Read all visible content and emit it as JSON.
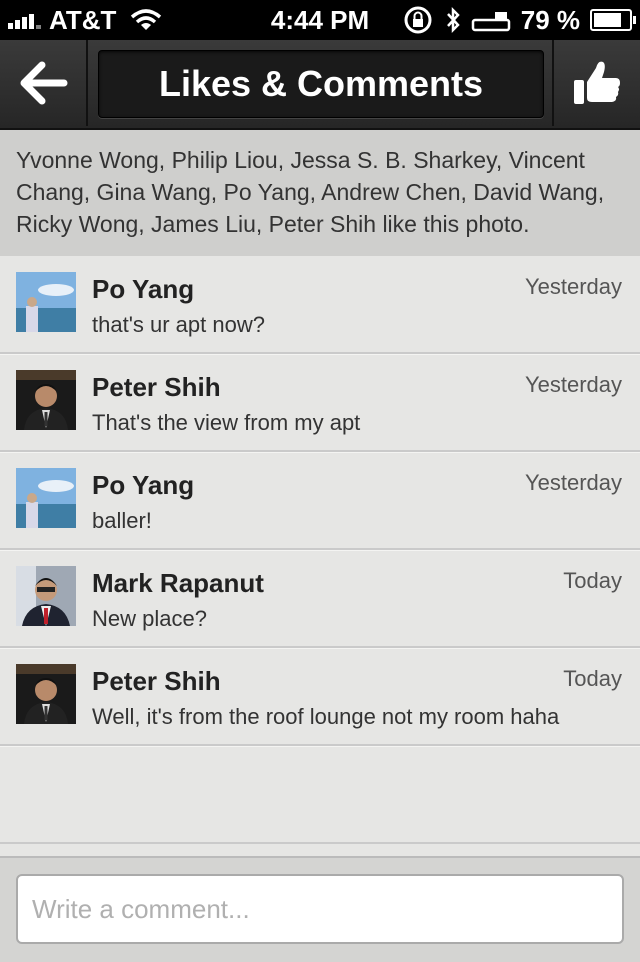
{
  "status_bar": {
    "carrier": "AT&T",
    "time": "4:44 PM",
    "battery": "79 %",
    "battery_level": 0.79
  },
  "nav": {
    "title": "Likes & Comments",
    "back_icon": "back-arrow-icon",
    "like_icon": "thumbs-up-icon"
  },
  "likes_text": "Yvonne Wong, Philip Liou, Jessa S. B. Sharkey, Vincent Chang, Gina Wang, Po Yang, Andrew Chen, David Wang, Ricky Wong, James Liu, Peter Shih like this photo.",
  "comments": [
    {
      "name": "Po Yang",
      "text": "that's ur apt now?",
      "time": "Yesterday",
      "avatar": "sky-avatar"
    },
    {
      "name": "Peter Shih",
      "text": "That's the view from my apt",
      "time": "Yesterday",
      "avatar": "suit-avatar"
    },
    {
      "name": "Po Yang",
      "text": "baller!",
      "time": "Yesterday",
      "avatar": "sky-avatar"
    },
    {
      "name": "Mark Rapanut",
      "text": "New place?",
      "time": "Today",
      "avatar": "redtie-avatar"
    },
    {
      "name": "Peter Shih",
      "text": "Well, it's from the roof lounge not my room haha",
      "time": "Today",
      "avatar": "suit-avatar"
    }
  ],
  "input": {
    "placeholder": "Write a comment..."
  }
}
